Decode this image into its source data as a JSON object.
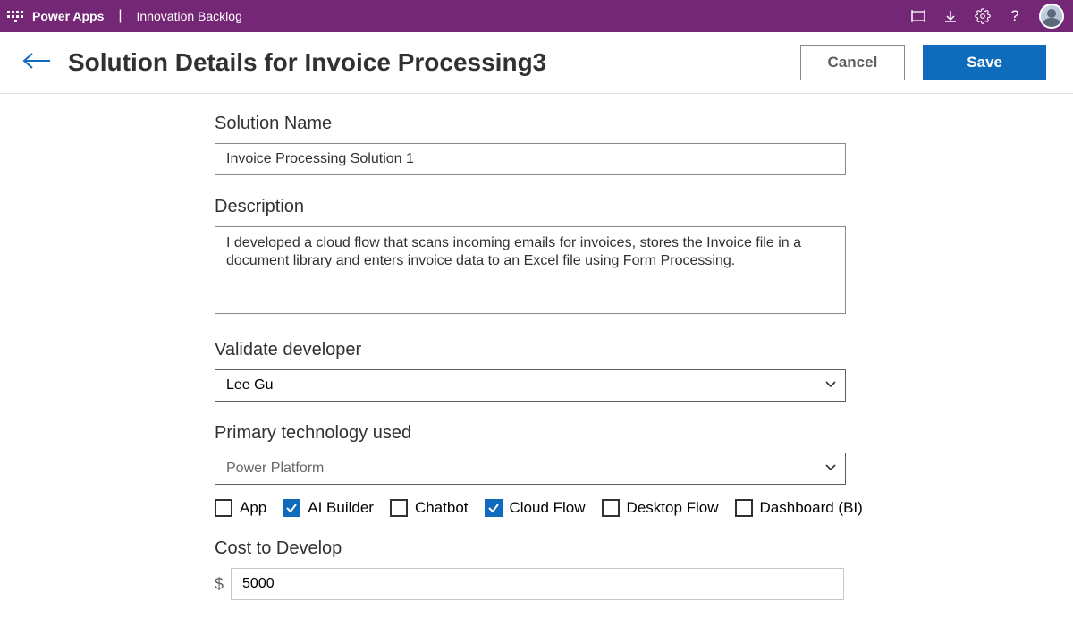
{
  "topbar": {
    "app_name": "Power Apps",
    "divider": "|",
    "breadcrumb": "Innovation Backlog"
  },
  "header": {
    "title": "Solution Details for Invoice Processing3",
    "cancel": "Cancel",
    "save": "Save"
  },
  "form": {
    "solution_name_label": "Solution Name",
    "solution_name_value": "Invoice Processing Solution 1",
    "description_label": "Description",
    "description_value": "I developed a cloud flow that scans incoming emails for invoices, stores the Invoice file in a document library and enters invoice data to an Excel file using Form Processing.",
    "validate_developer_label": "Validate developer",
    "validate_developer_value": "Lee Gu",
    "primary_tech_label": "Primary technology used",
    "primary_tech_value": "Power Platform",
    "checkboxes": {
      "app": {
        "label": "App",
        "checked": false
      },
      "ai_builder": {
        "label": "AI Builder",
        "checked": true
      },
      "chatbot": {
        "label": "Chatbot",
        "checked": false
      },
      "cloud_flow": {
        "label": "Cloud Flow",
        "checked": true
      },
      "desktop_flow": {
        "label": "Desktop Flow",
        "checked": false
      },
      "dashboard": {
        "label": "Dashboard (BI)",
        "checked": false
      }
    },
    "cost_label": "Cost to Develop",
    "cost_currency": "$",
    "cost_value": "5000"
  }
}
